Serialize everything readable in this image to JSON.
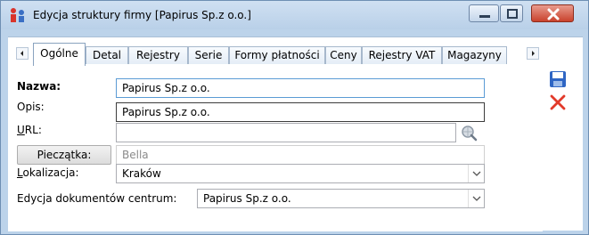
{
  "window": {
    "title": "Edycja struktury firmy [Papirus Sp.z o.o.]"
  },
  "tabs": [
    {
      "label": "Ogólne",
      "active": true
    },
    {
      "label": "Detal",
      "active": false
    },
    {
      "label": "Rejestry",
      "active": false
    },
    {
      "label": "Serie",
      "active": false
    },
    {
      "label": "Formy płatności",
      "active": false
    },
    {
      "label": "Ceny",
      "active": false
    },
    {
      "label": "Rejestry VAT",
      "active": false
    },
    {
      "label": "Magazyny",
      "active": false
    }
  ],
  "form": {
    "nazwa_label": "Nazwa:",
    "nazwa_value": "Papirus Sp.z o.o.",
    "opis_label": "Opis:",
    "opis_value": "Papirus Sp.z o.o.",
    "url_label_u": "U",
    "url_label_rest": "RL:",
    "url_value": "",
    "pieczatka_button": "Pieczątka:",
    "pieczatka_value": "Bella",
    "lokalizacja_label_u": "L",
    "lokalizacja_label_rest": "okalizacja:",
    "lokalizacja_value": "Kraków",
    "edycja_label": "Edycja dokumentów centrum:",
    "edycja_value": "Papirus Sp.z o.o."
  },
  "icons": {
    "app": "structure-icon",
    "save": "save-icon",
    "cancel": "cancel-icon",
    "url_browse": "globe-search-icon"
  },
  "colors": {
    "frame": "#bcd3ea",
    "focus_border": "#5b9bd5",
    "cancel_red": "#e23a2a",
    "save_blue": "#2f66c4"
  }
}
